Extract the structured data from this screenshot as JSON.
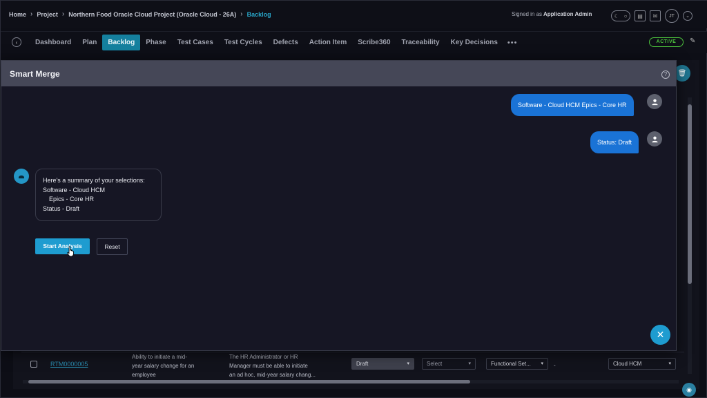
{
  "breadcrumb": {
    "items": [
      "Home",
      "Project",
      "Northern Food Oracle Cloud Project (Oracle Cloud - 26A)",
      "Backlog"
    ]
  },
  "header": {
    "signed_in_prefix": "Signed in as",
    "signed_in_user": "Application Admin",
    "avatar_initials": "JT"
  },
  "nav": {
    "tabs": [
      "Dashboard",
      "Plan",
      "Backlog",
      "Phase",
      "Test Cases",
      "Test Cycles",
      "Defects",
      "Action Item",
      "Scribe360",
      "Traceability",
      "Key Decisions"
    ],
    "active_tab": "Backlog",
    "more": "•••",
    "status_badge": "ACTIVE"
  },
  "modal": {
    "title": "Smart Merge",
    "user_messages": [
      "Software - Cloud HCM Epics - Core HR",
      "Status: Draft"
    ],
    "bot_summary": {
      "intro": "Here's a summary of your selections:",
      "line1": "Software - Cloud HCM",
      "line2": "Epics - Core HR",
      "line3": "Status - Draft"
    },
    "start_button": "Start Analysis",
    "reset_button": "Reset"
  },
  "table_row": {
    "id": "RTM0000005",
    "title_l1": "Ability to initiate a mid-",
    "title_l2": "year salary change for an",
    "title_l3": "employee",
    "desc_l1": "The HR Administrator or HR",
    "desc_l2": "Manager must be able to initiate",
    "desc_l3": "an ad hoc, mid-year salary chang...",
    "status": "Draft",
    "select_placeholder": "Select",
    "type": "Functional Set...",
    "dash": "-",
    "software": "Cloud HCM"
  },
  "colors": {
    "accent": "#1e9cd0",
    "user_bubble": "#1a73d6",
    "active_badge": "#4cc23c",
    "modal_header": "#454757"
  }
}
